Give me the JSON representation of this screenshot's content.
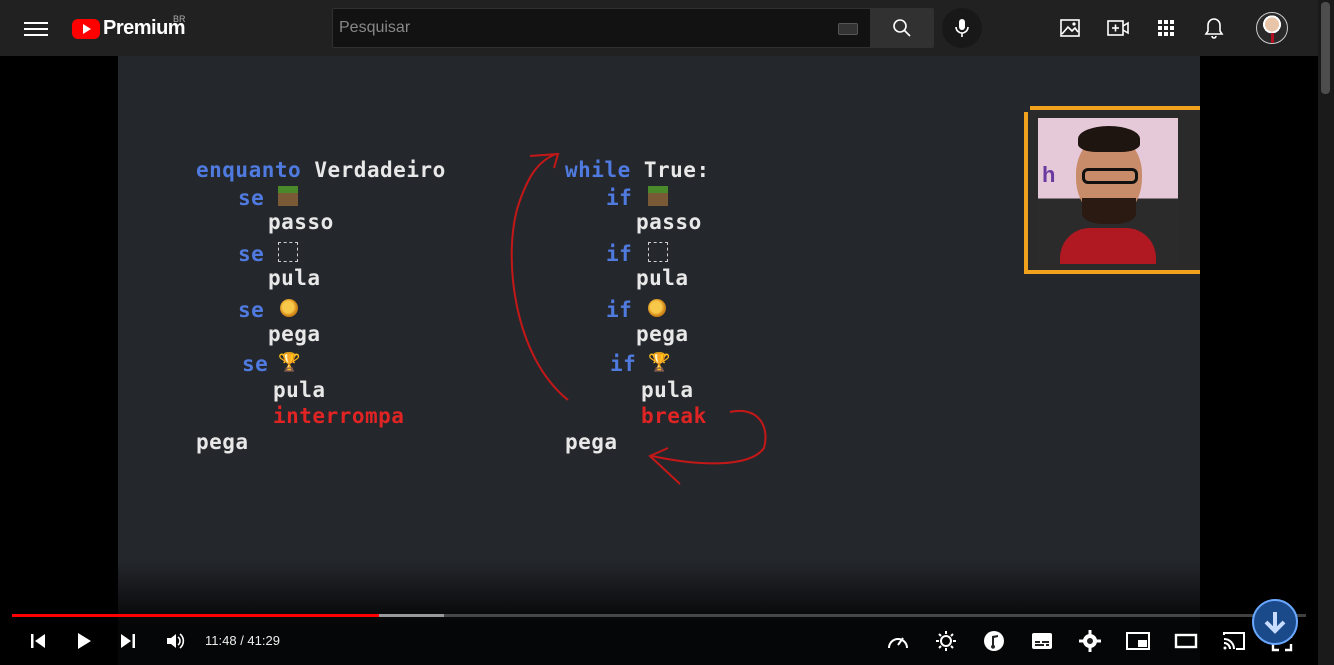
{
  "topbar": {
    "logo_text": "Premium",
    "logo_region": "BR",
    "search_placeholder": "Pesquisar"
  },
  "video": {
    "left_code": {
      "line1_kw": "enquanto",
      "line1_rest": "Verdadeiro",
      "se": "se",
      "passo": "passo",
      "pula": "pula",
      "pega": "pega",
      "interrompa": "interrompa",
      "final": "pega"
    },
    "right_code": {
      "line1_kw": "while",
      "line1_rest": "True:",
      "if": "if",
      "passo": "passo",
      "pula": "pula",
      "pega": "pega",
      "break": "break",
      "final": "pega"
    },
    "facecam_text": "h"
  },
  "player": {
    "current_time": "11:48",
    "duration": "41:29",
    "time_separator": " / ",
    "progress_fraction": 0.284,
    "buffer_fraction": 0.334
  },
  "colors": {
    "keyword": "#4f7be0",
    "text": "#e8e8e8",
    "break": "#e02424",
    "progress": "#ff0000",
    "frame": "#f0a21c"
  }
}
